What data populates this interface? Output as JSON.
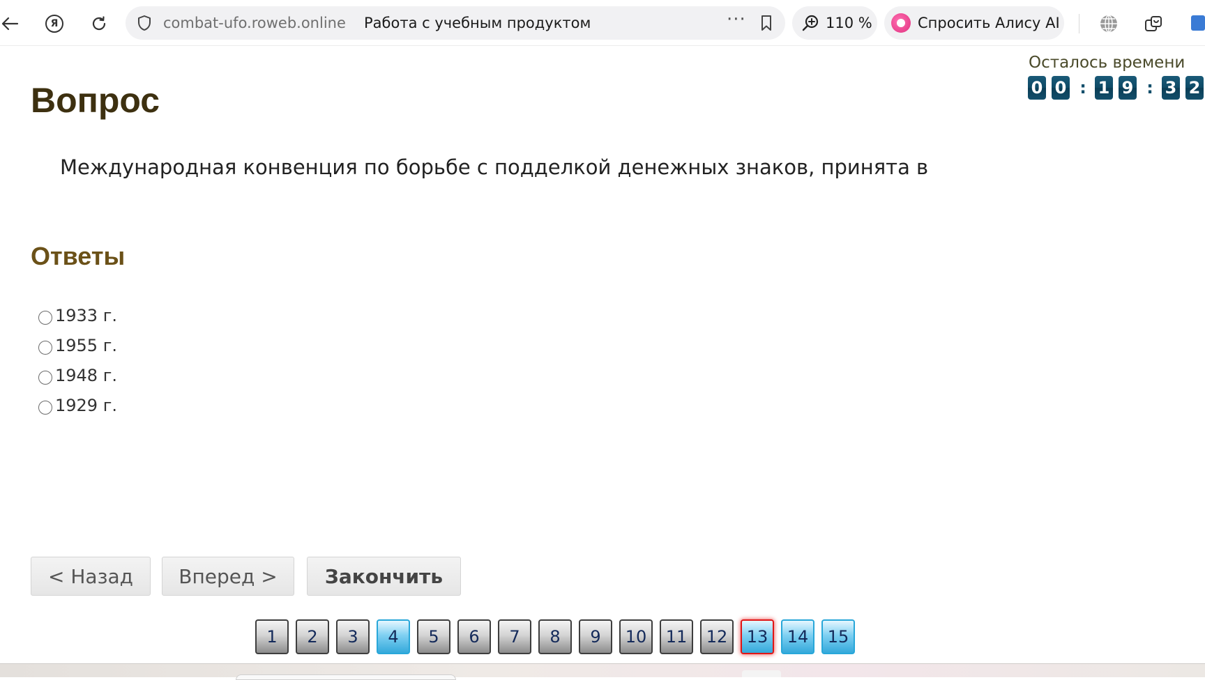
{
  "browser": {
    "url_domain": "combat-ufo.roweb.online",
    "page_title": "Работа с учебным продуктом",
    "zoom": "110 %",
    "alice_label": "Спросить Алису AI",
    "more_dots": "···"
  },
  "timer": {
    "label": "Осталось времени",
    "digits": [
      "0",
      "0",
      "1",
      "9",
      "3",
      "2"
    ],
    "separator": ":"
  },
  "question": {
    "heading": "Вопрос",
    "text": "Международная конвенция по борьбе с подделкой денежных знаков, принята в"
  },
  "answers": {
    "heading": "Ответы",
    "options": [
      "1933 г.",
      "1955 г.",
      "1948 г.",
      "1929 г."
    ]
  },
  "nav": {
    "back": "< Назад",
    "next": "Вперед >",
    "finish": "Закончить"
  },
  "pager": {
    "pages": [
      "1",
      "2",
      "3",
      "4",
      "5",
      "6",
      "7",
      "8",
      "9",
      "10",
      "11",
      "12",
      "13",
      "14",
      "15"
    ],
    "answered": [
      "4",
      "14",
      "15"
    ],
    "current": "13"
  },
  "colors": {
    "heading": "#3d3010",
    "answers_heading": "#6b5118",
    "timer_digit": "#134f6b",
    "current_border": "#e01616",
    "answered_fill": "#34a9db"
  }
}
